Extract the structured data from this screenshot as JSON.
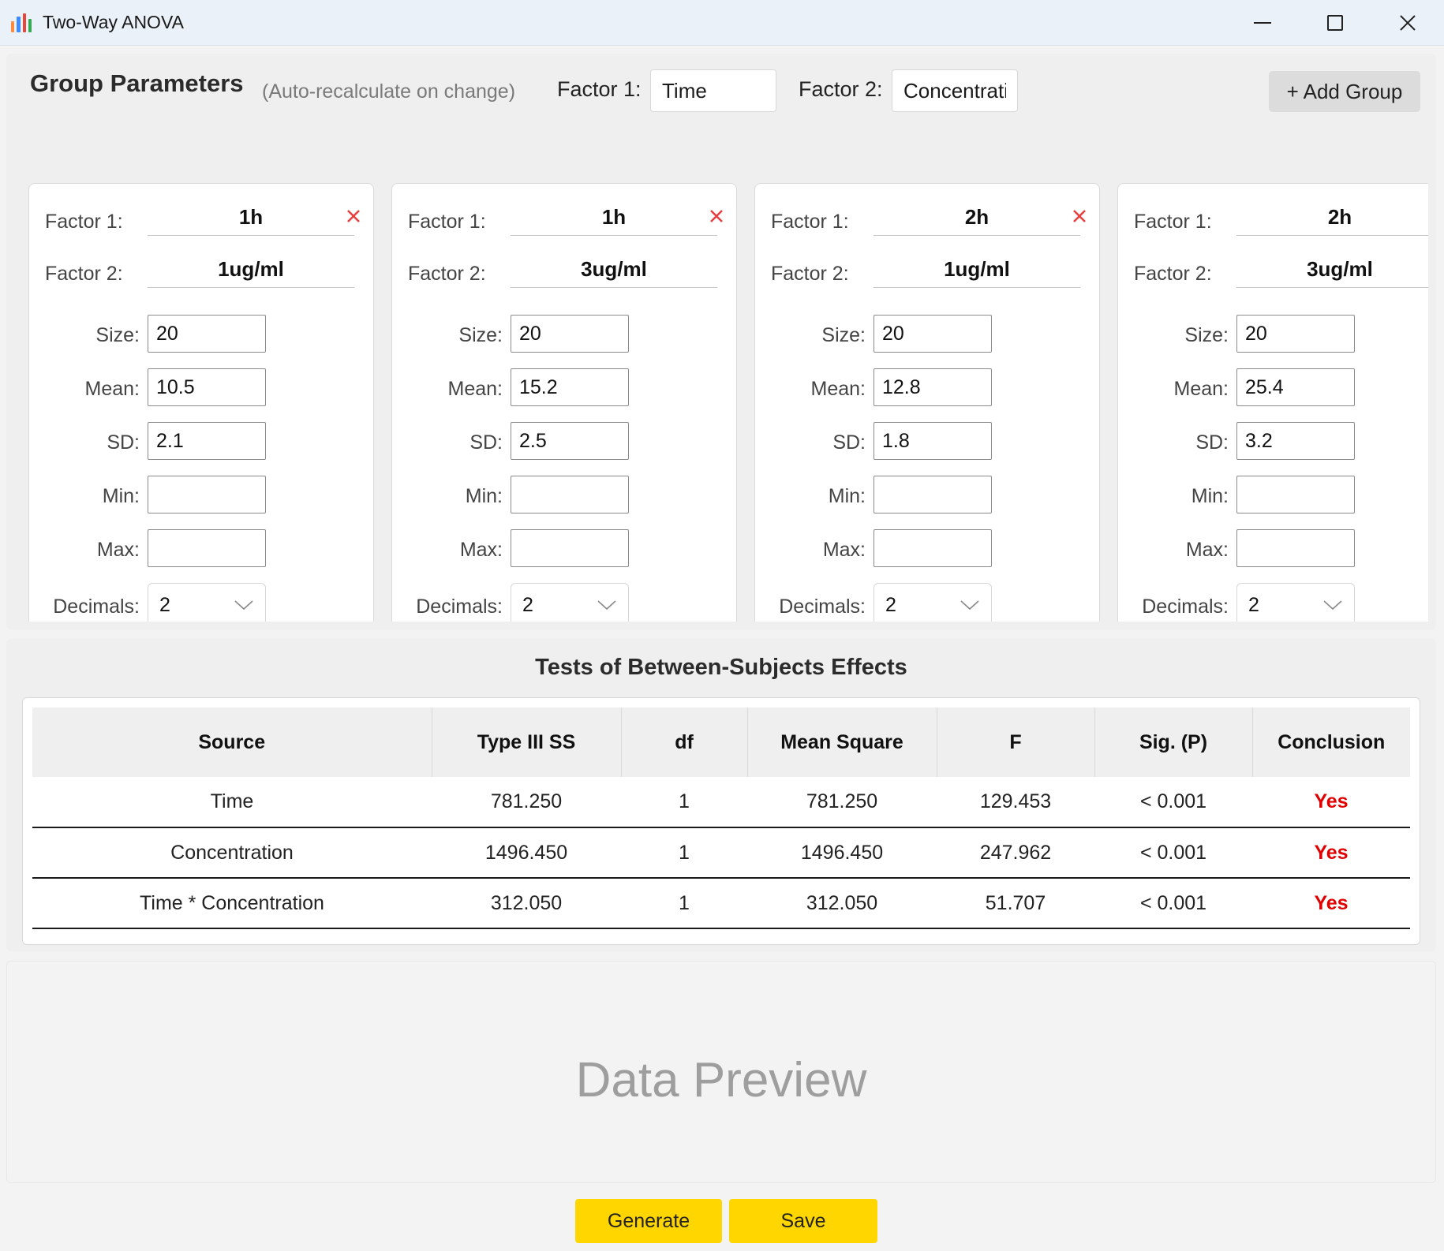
{
  "window": {
    "title": "Two-Way ANOVA",
    "icon": "bar-chart-icon",
    "icon_colors": [
      "#ff8a3d",
      "#3d8bff",
      "#e8453c",
      "#34a853"
    ]
  },
  "params": {
    "title": "Group Parameters",
    "subtitle": "(Auto-recalculate on change)",
    "factor1_label": "Factor 1:",
    "factor1_value": "Time",
    "factor2_label": "Factor 2:",
    "factor2_value": "Concentrati",
    "add_group_label": "+ Add Group"
  },
  "groups": [
    {
      "factor1_label": "Factor 1:",
      "factor1": "1h",
      "factor2_label": "Factor 2:",
      "factor2": "1ug/ml",
      "size_label": "Size:",
      "size": "20",
      "mean_label": "Mean:",
      "mean": "10.5",
      "sd_label": "SD:",
      "sd": "2.1",
      "min_label": "Min:",
      "min": "",
      "max_label": "Max:",
      "max": "",
      "decimals_label": "Decimals:",
      "decimals": "2"
    },
    {
      "factor1_label": "Factor 1:",
      "factor1": "1h",
      "factor2_label": "Factor 2:",
      "factor2": "3ug/ml",
      "size_label": "Size:",
      "size": "20",
      "mean_label": "Mean:",
      "mean": "15.2",
      "sd_label": "SD:",
      "sd": "2.5",
      "min_label": "Min:",
      "min": "",
      "max_label": "Max:",
      "max": "",
      "decimals_label": "Decimals:",
      "decimals": "2"
    },
    {
      "factor1_label": "Factor 1:",
      "factor1": "2h",
      "factor2_label": "Factor 2:",
      "factor2": "1ug/ml",
      "size_label": "Size:",
      "size": "20",
      "mean_label": "Mean:",
      "mean": "12.8",
      "sd_label": "SD:",
      "sd": "1.8",
      "min_label": "Min:",
      "min": "",
      "max_label": "Max:",
      "max": "",
      "decimals_label": "Decimals:",
      "decimals": "2"
    },
    {
      "factor1_label": "Factor 1:",
      "factor1": "2h",
      "factor2_label": "Factor 2:",
      "factor2": "3ug/ml",
      "size_label": "Size:",
      "size": "20",
      "mean_label": "Mean:",
      "mean": "25.4",
      "sd_label": "SD:",
      "sd": "3.2",
      "min_label": "Min:",
      "min": "",
      "max_label": "Max:",
      "max": "",
      "decimals_label": "Decimals:",
      "decimals": "2"
    }
  ],
  "results": {
    "title": "Tests of Between-Subjects Effects",
    "columns": [
      "Source",
      "Type III SS",
      "df",
      "Mean Square",
      "F",
      "Sig. (P)",
      "Conclusion"
    ],
    "rows": [
      [
        "Time",
        "781.250",
        "1",
        "781.250",
        "129.453",
        "< 0.001",
        "Yes"
      ],
      [
        "Concentration",
        "1496.450",
        "1",
        "1496.450",
        "247.962",
        "< 0.001",
        "Yes"
      ],
      [
        "Time * Concentration",
        "312.050",
        "1",
        "312.050",
        "51.707",
        "< 0.001",
        "Yes"
      ]
    ],
    "conclusion_color": "#e00000"
  },
  "preview": {
    "placeholder": "Data Preview"
  },
  "actions": {
    "generate_label": "Generate",
    "save_label": "Save",
    "button_color": "#ffd600"
  }
}
